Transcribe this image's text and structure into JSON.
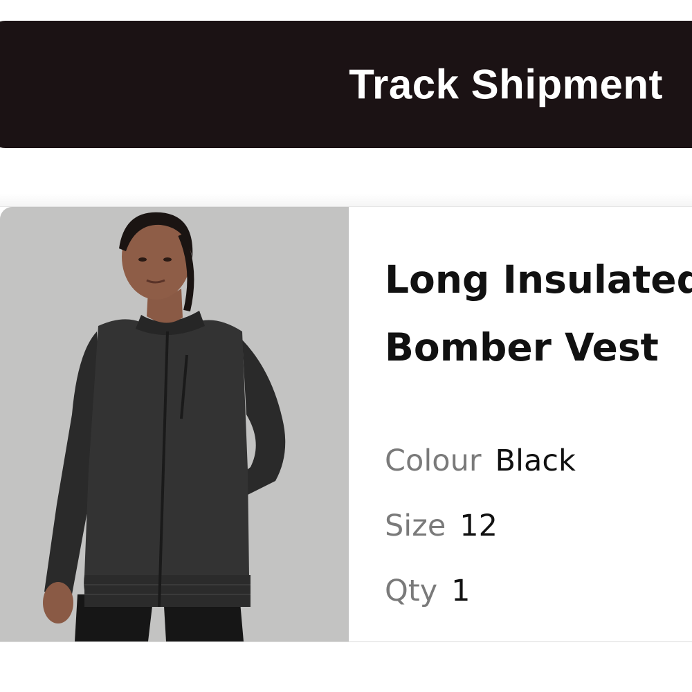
{
  "actions": {
    "track_shipment_label": "Track Shipment"
  },
  "product": {
    "title_line1": "Long Insulated",
    "title_line2": "Bomber Vest",
    "colour_label": "Colour",
    "colour_value": "Black",
    "size_label": "Size",
    "size_value": "12",
    "qty_label": "Qty",
    "qty_value": "1"
  },
  "colors": {
    "button_background": "#1b1214",
    "button_text": "#ffffff",
    "label_text": "#7a7a7a",
    "value_text": "#111111"
  }
}
